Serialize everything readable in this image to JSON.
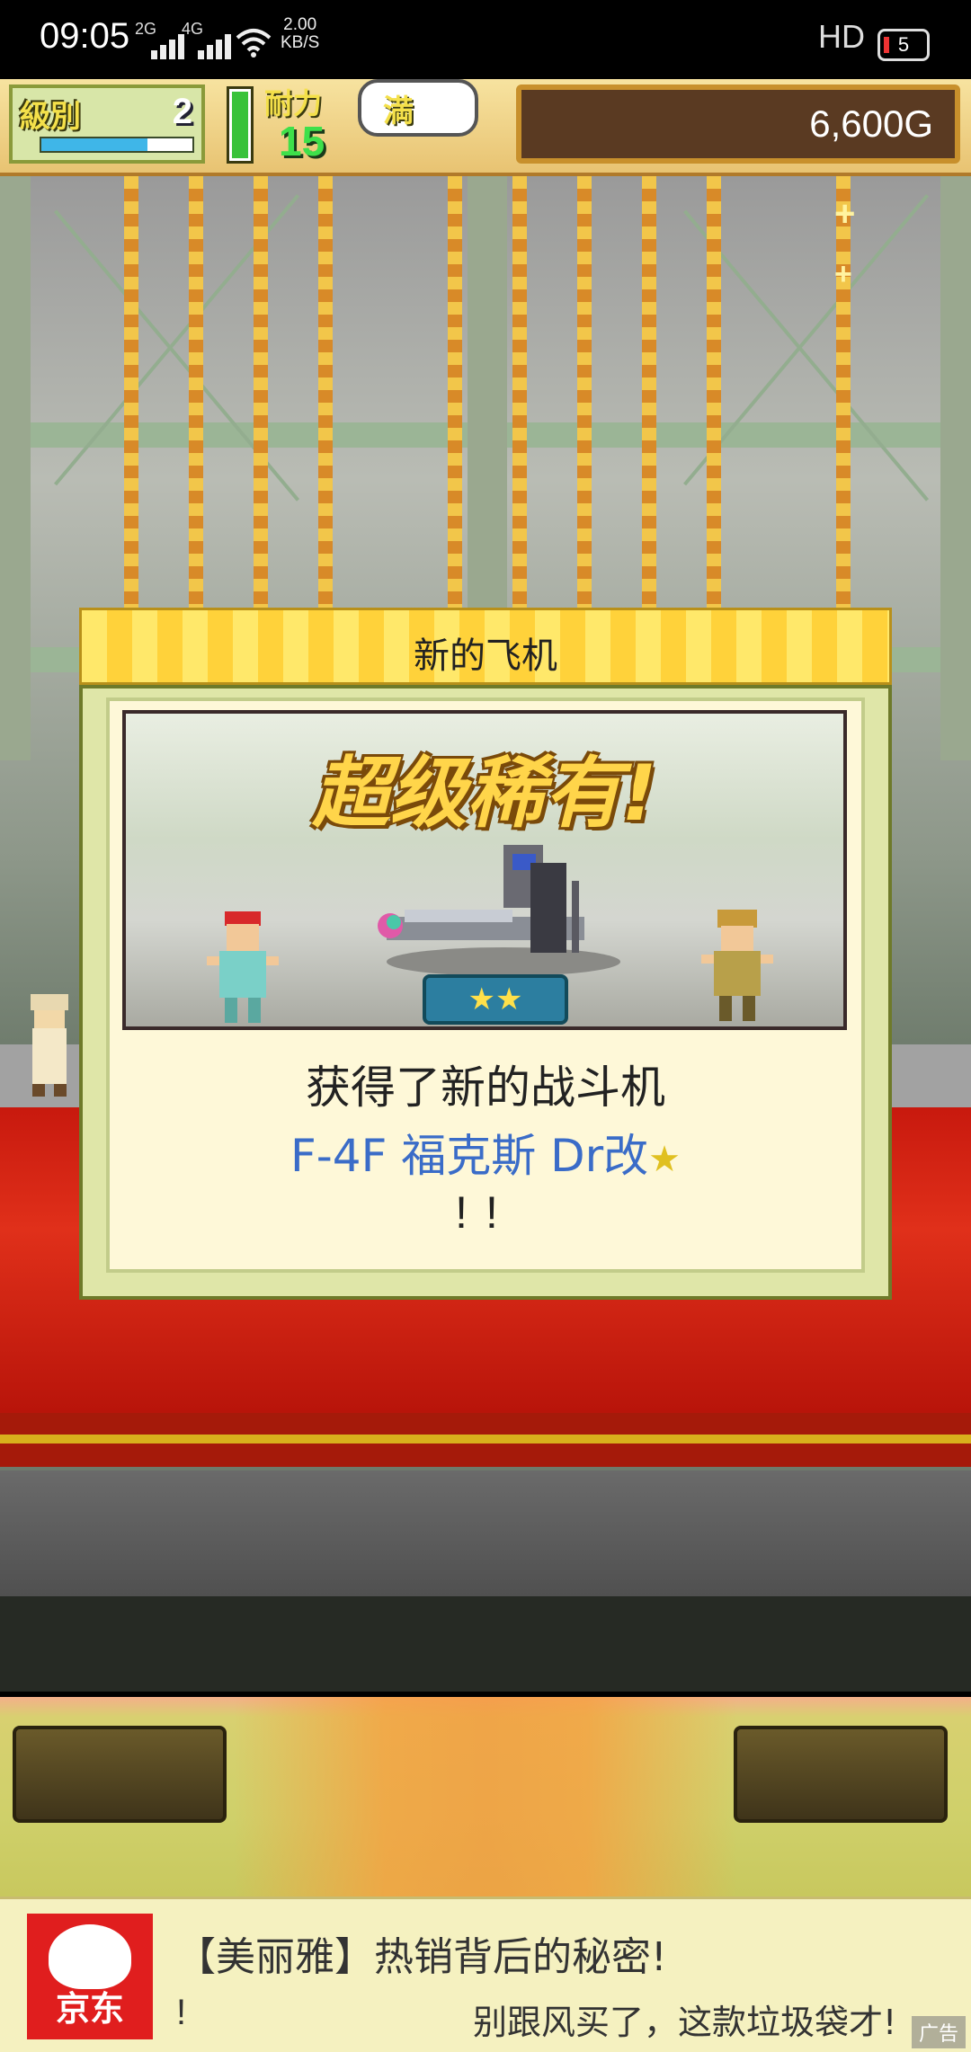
{
  "status_bar": {
    "time": "09:05",
    "net1": "2G",
    "net2": "4G",
    "speed_value": "2.00",
    "speed_unit": "KB/S",
    "hd": "HD",
    "battery": "5"
  },
  "hud": {
    "level_label": "級別",
    "level_value": "2",
    "level_progress": 0.7,
    "stamina_label": "耐力",
    "stamina_value": "15",
    "stamina_status": "満",
    "gold": "6,600G"
  },
  "dialog": {
    "title": "新的飞机",
    "banner_text": "超级稀有!",
    "rarity_stars": "★★",
    "message_line1": "获得了新的战斗机",
    "plane_name": "F-4F 福克斯 Dr改",
    "plane_badge": "★",
    "message_line3": "!!"
  },
  "ad": {
    "brand": "京东",
    "title": "【美丽雅】热销背后的秘密!",
    "exclaim": "!",
    "subtitle": "别跟风买了，这款垃圾袋才!",
    "tag": "广告"
  },
  "colors": {
    "accent_gold": "#ffd23a",
    "plane_name_blue": "#3a6cc8",
    "carpet_red": "#c8190e",
    "ad_red": "#e01e1e"
  }
}
